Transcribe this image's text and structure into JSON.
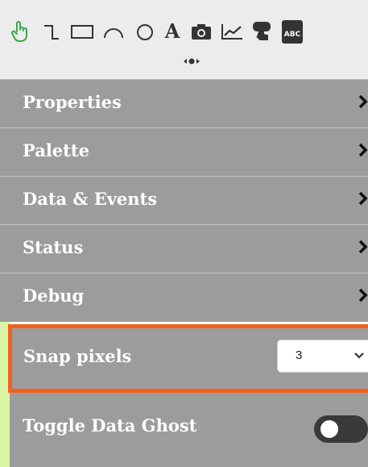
{
  "toolbar": {
    "tools": [
      {
        "icon": "pointer-hand-icon",
        "color": "#39a84a"
      },
      {
        "icon": "connector-line-icon"
      },
      {
        "icon": "rectangle-icon"
      },
      {
        "icon": "arc-icon"
      },
      {
        "icon": "circle-icon"
      },
      {
        "icon": "text-icon",
        "glyph": "A"
      },
      {
        "icon": "camera-icon"
      },
      {
        "icon": "line-chart-icon"
      },
      {
        "icon": "touch-button-icon"
      },
      {
        "icon": "text-box-icon",
        "glyph": "ABC"
      }
    ],
    "handle_icon": "drag-handle-icon"
  },
  "menu": {
    "items": [
      {
        "label": "Properties"
      },
      {
        "label": "Palette"
      },
      {
        "label": "Data & Events"
      },
      {
        "label": "Status"
      },
      {
        "label": "Debug"
      }
    ],
    "chevron_icon": "chevron-right-icon"
  },
  "snap": {
    "label": "Snap pixels",
    "value": "3",
    "highlight_color": "#f2601e"
  },
  "ghost": {
    "label": "Toggle Data Ghost",
    "enabled": false
  },
  "colors": {
    "panel_bg": "#9c9c9c",
    "toolbar_bg": "#ececec",
    "tint": "#d9f5a6"
  }
}
